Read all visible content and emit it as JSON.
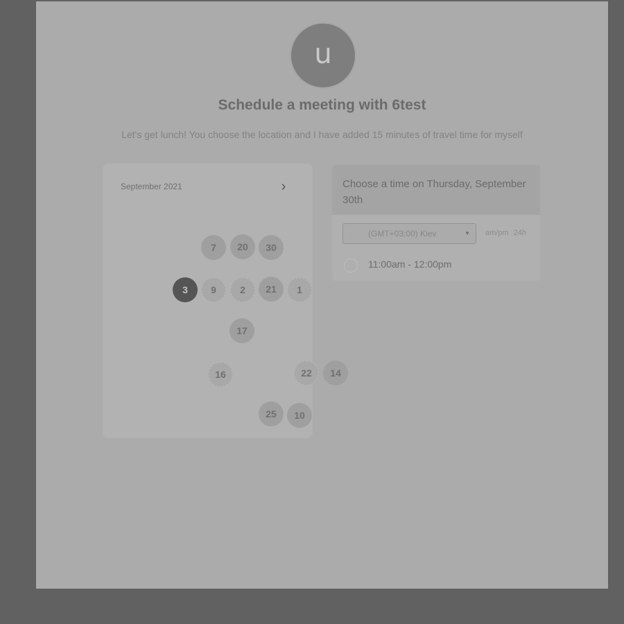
{
  "host": {
    "avatar_letter": "u",
    "title": "Schedule a meeting with 6test",
    "description": "Let's get lunch! You choose the location and I have added 15 minutes of travel time for myself"
  },
  "calendar": {
    "month_label": "September 2021",
    "next_icon": "chevron-right-icon",
    "selected_day": "3",
    "days": [
      "7",
      "20",
      "30",
      "3",
      "9",
      "2",
      "21",
      "1",
      "17",
      "16",
      "22",
      "14",
      "25",
      "10"
    ]
  },
  "time_picker": {
    "heading": "Choose a time on Thursday, September 30th",
    "timezone": "(GMT+03:00) Kiev",
    "format_options": [
      "am/pm",
      "24h"
    ],
    "slots": [
      "11:00am - 12:00pm"
    ]
  },
  "colors": {
    "backdrop": "#616161",
    "page": "#ababab",
    "selected_day": "#555555",
    "day_bubble": "#9f9f9f"
  }
}
